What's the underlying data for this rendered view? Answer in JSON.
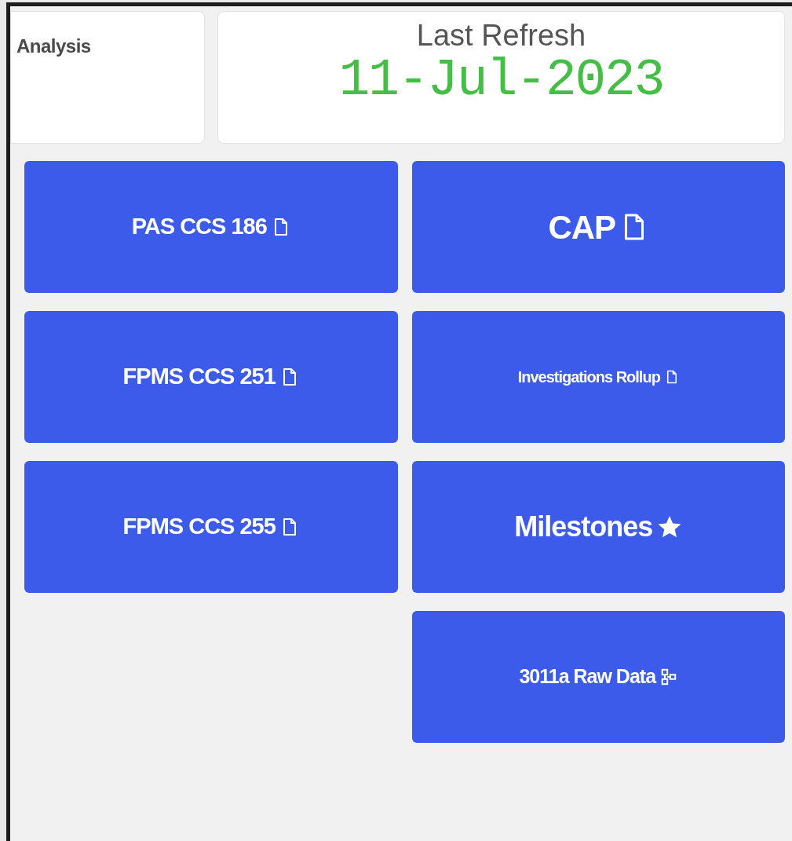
{
  "title_card": {
    "text": "Analysis"
  },
  "refresh_card": {
    "label": "Last Refresh",
    "date": "11-Jul-2023"
  },
  "columns": [
    [
      {
        "label": "PAS CCS 186",
        "kind": "document"
      },
      {
        "label": "FPMS CCS 251",
        "kind": "document"
      },
      {
        "label": "FPMS CCS 255",
        "kind": "document"
      }
    ],
    [
      {
        "label": "CAP",
        "kind": "document"
      },
      {
        "label": "Investigations Rollup",
        "kind": "document"
      },
      {
        "label": "Milestones",
        "kind": "star"
      },
      {
        "label": "3011a Raw Data",
        "kind": "nodes"
      }
    ]
  ]
}
